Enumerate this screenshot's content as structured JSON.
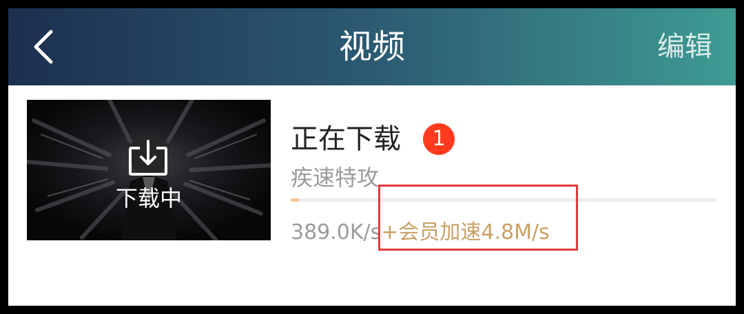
{
  "header": {
    "back_icon": "chevron-left-icon",
    "title": "视频",
    "edit_label": "编辑"
  },
  "download_item": {
    "thumbnail_label": "下载中",
    "download_icon": "download-icon",
    "name": "正在下载",
    "badge_count": "1",
    "title": "疾速特攻",
    "progress": 0.02,
    "speed": "389.0K/s",
    "vip_boost": "+会员加速4.8M/s"
  },
  "colors": {
    "header_gradient_start": "#1c2f4f",
    "header_gradient_end": "#3e9b92",
    "badge": "#ff3b1f",
    "vip_text": "#c9a064",
    "highlight_box": "#e33b3b",
    "progress_fill": "#f1c98e"
  }
}
